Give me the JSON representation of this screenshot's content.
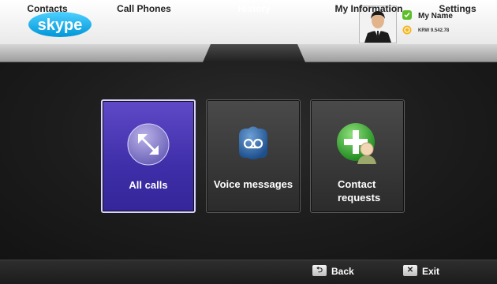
{
  "app": {
    "logo_text": "skype"
  },
  "user": {
    "name": "My Name",
    "credit": "KRW 9.542.78"
  },
  "tabs": [
    {
      "label": "Contacts"
    },
    {
      "label": "Call Phones"
    },
    {
      "label": "History"
    },
    {
      "label": "My Information"
    },
    {
      "label": "Settings"
    }
  ],
  "tiles": [
    {
      "label": "All calls",
      "icon": "arrows-expand-icon"
    },
    {
      "label": "Voice messages",
      "icon": "voicemail-icon"
    },
    {
      "label": "Contact requests",
      "icon": "add-contact-icon"
    }
  ],
  "footer": {
    "back_label": "Back",
    "back_key": "⮌",
    "exit_label": "Exit",
    "exit_key": "✕"
  },
  "colors": {
    "accent_selected": "#4a37b8",
    "skype_blue": "#00aff0"
  }
}
